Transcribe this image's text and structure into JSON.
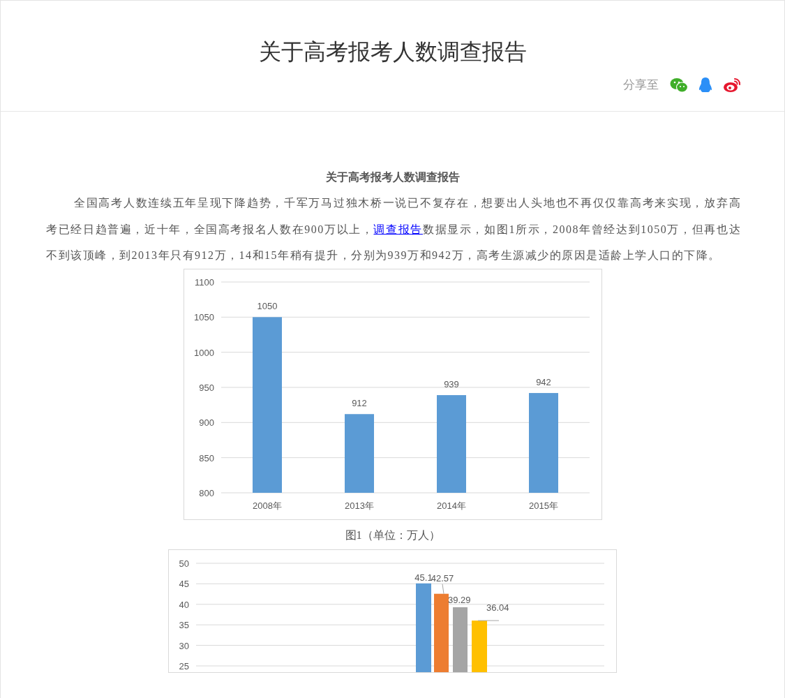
{
  "header": {
    "title": "关于高考报考人数调查报告",
    "share_label": "分享至"
  },
  "article": {
    "title": "关于高考报考人数调查报告",
    "paragraph": [
      {
        "kind": "text",
        "text": "全国高考人数连续五年呈现下降趋势，千军万马过独木桥一说已不复存在，想要出人头地也不再仅仅靠高考来实现，放弃高考已经日趋普遍，近十年，全国高考报名人数在900万以上，"
      },
      {
        "kind": "link",
        "text": "调查报告"
      },
      {
        "kind": "text",
        "text": "数据显示，如图1所示，2008年曾经达到1050万，但再也达不到该顶峰，到2013年只有912万，14和15年稍有提升，分别为939万和942万，高考生源减少的原因是适龄上学人口的下降。"
      }
    ],
    "figures": [
      {
        "caption": "图1（单位：万人）",
        "chart_data": {
          "type": "bar",
          "categories": [
            "2008年",
            "2013年",
            "2014年",
            "2015年"
          ],
          "series": [
            {
              "color": "#5b9bd5",
              "values": [
                1050,
                912,
                939,
                942
              ]
            }
          ],
          "ylim": [
            800,
            1100
          ],
          "grid": true,
          "yticks": [
            800,
            850,
            900,
            950,
            1000,
            1050,
            1100
          ],
          "data_labels": true
        }
      },
      {
        "chart_data": {
          "type": "bar",
          "ylim": [
            22.8,
            50
          ],
          "grid": true,
          "yticks": [
            25,
            30,
            35,
            40,
            45,
            50
          ],
          "data_labels": true,
          "series": [
            {
              "color": "#5b9bd5",
              "values": [
                45.1
              ]
            },
            {
              "color": "#ed7d31",
              "values": [
                42.57
              ]
            },
            {
              "color": "#a5a5a5",
              "values": [
                39.29
              ]
            },
            {
              "color": "#ffc000",
              "values": [
                36.04
              ]
            }
          ]
        }
      }
    ]
  }
}
